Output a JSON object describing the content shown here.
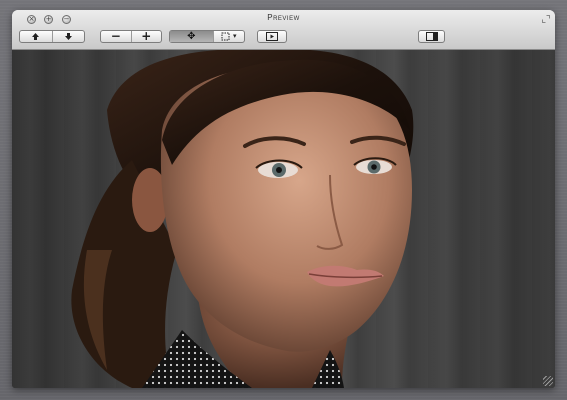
{
  "window": {
    "title": "Preview"
  },
  "traffic_lights": {
    "close_glyph": "×",
    "minimize_glyph": "−",
    "zoom_glyph": "+"
  },
  "toolbar": {
    "previous_glyph": "▲",
    "next_glyph": "▼",
    "zoom_out_glyph": "−",
    "zoom_in_glyph": "+",
    "move_tool_glyph": "✥",
    "select_tool_glyph": "⬚",
    "select_dropdown_glyph": "▾",
    "slideshow_glyph": "▶",
    "sidebar_glyph": "▭"
  },
  "icons": {
    "close": "close-icon",
    "minimize": "minimize-icon",
    "zoom": "zoom-icon",
    "fullscreen": "fullscreen-icon",
    "previous": "arrow-up-icon",
    "next": "arrow-down-icon",
    "zoom_out": "minus-icon",
    "zoom_in": "plus-icon",
    "move": "move-tool-icon",
    "select": "rectangle-select-icon",
    "slideshow": "slideshow-icon",
    "sidebar": "sidebar-icon"
  },
  "colors": {
    "window_chrome": "#d7d7d7",
    "desktop": "#6f6f73",
    "active_segment": "#9c9c9c"
  }
}
